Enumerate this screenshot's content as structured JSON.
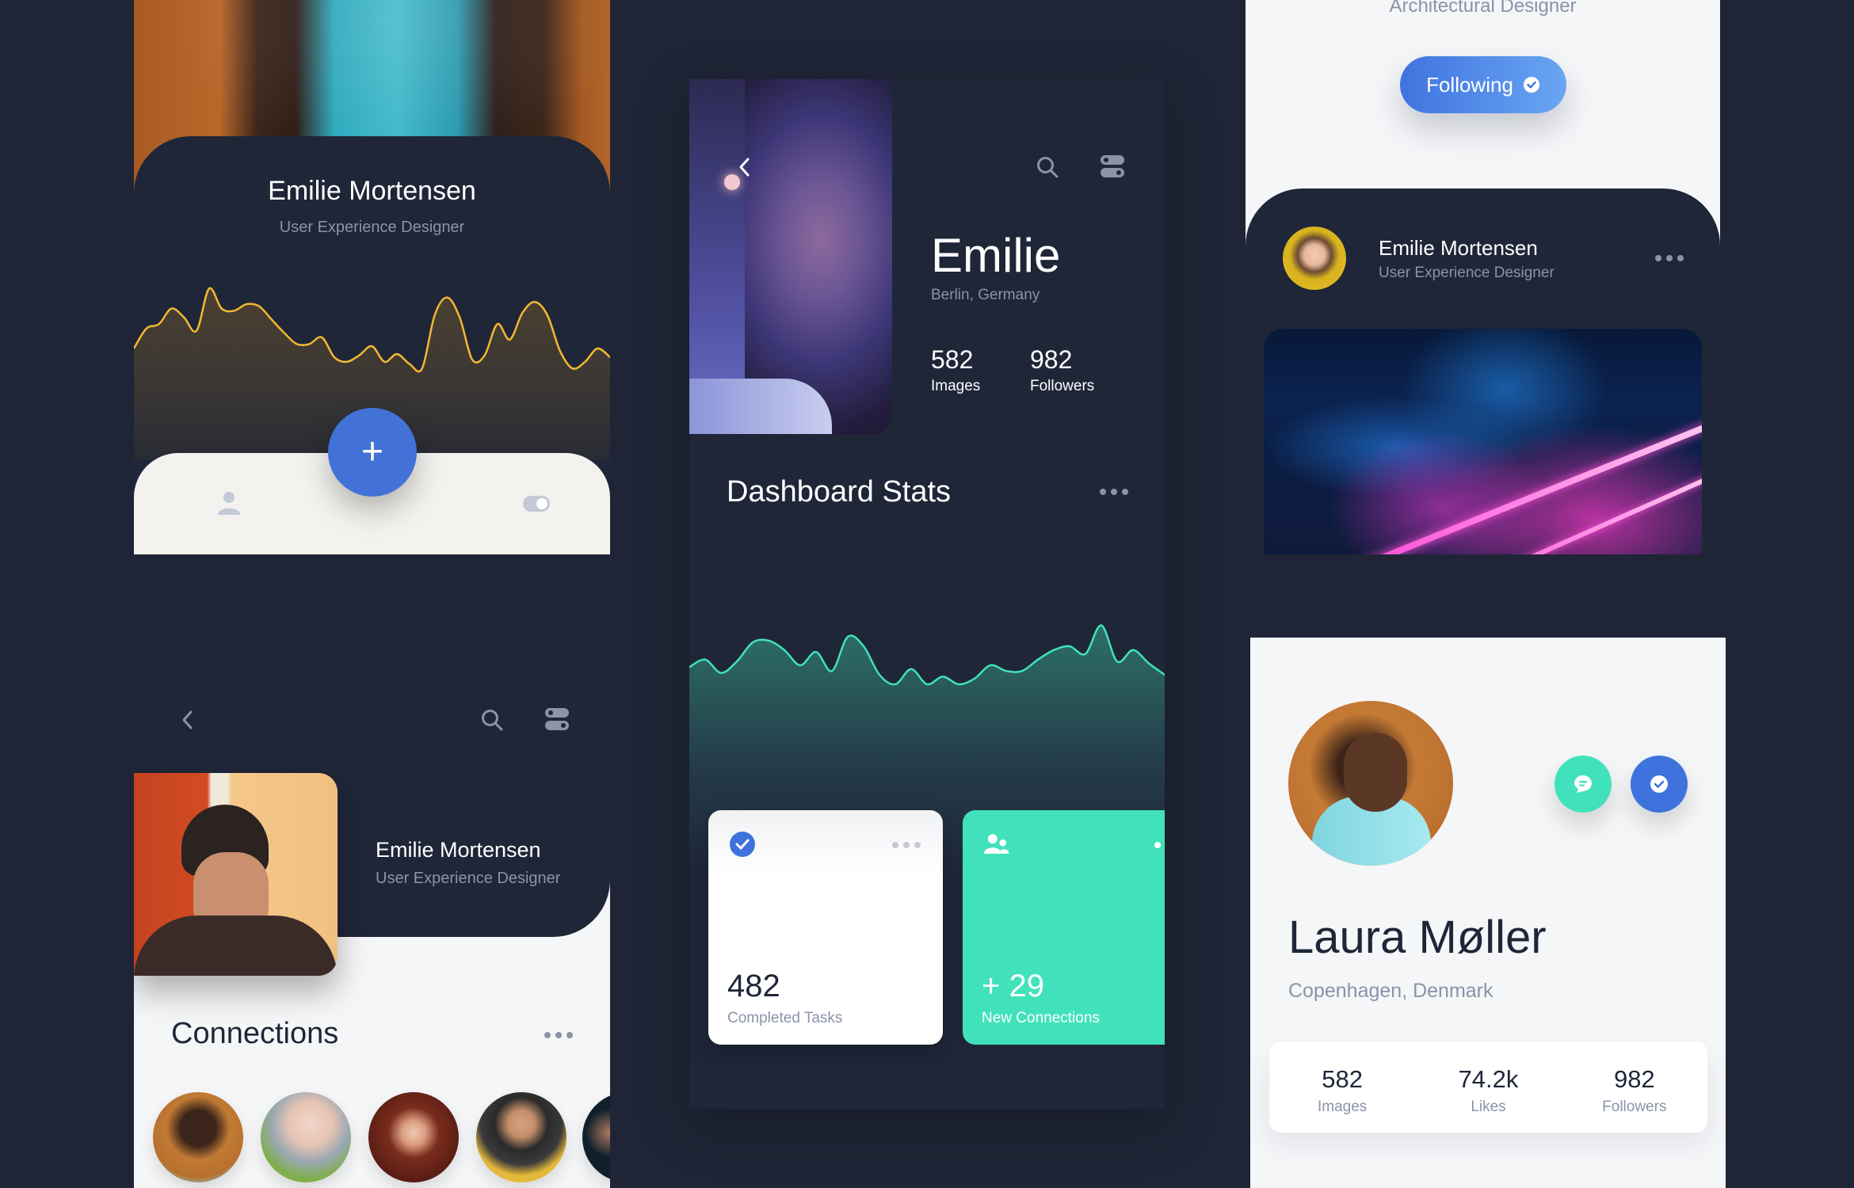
{
  "colors": {
    "background": "#1f2536",
    "panel_dark": "#1f2638",
    "panel_light": "#f5f6f8",
    "accent_blue": "#4272d7",
    "accent_teal": "#41e2bb",
    "accent_yellow": "#f5b731",
    "muted_text": "#8a93a8"
  },
  "card_profile_chart": {
    "name": "Emilie Mortensen",
    "role": "User Experience Designer",
    "fab_label": "+",
    "nav_icons": [
      "user-icon",
      "toggle-icon"
    ]
  },
  "card_dashboard": {
    "first_name": "Emilie",
    "location": "Berlin, Germany",
    "stats": [
      {
        "value": "582",
        "label": "Images"
      },
      {
        "value": "982",
        "label": "Followers"
      }
    ],
    "section_title": "Dashboard Stats",
    "tiles": [
      {
        "value": "482",
        "label": "Completed Tasks",
        "icon": "check-circle-icon"
      },
      {
        "value": "+ 29",
        "label": "New Connections",
        "icon": "users-icon"
      }
    ]
  },
  "card_following": {
    "role_top": "Architectural Designer",
    "follow_label": "Following",
    "name": "Emilie Mortensen",
    "role": "User Experience Designer"
  },
  "card_connections": {
    "name": "Emilie Mortensen",
    "role": "User Experience Designer",
    "section_title": "Connections",
    "avatar_count": 5
  },
  "card_laura": {
    "name": "Laura Møller",
    "location": "Copenhagen, Denmark",
    "stats": [
      {
        "value": "582",
        "label": "Images"
      },
      {
        "value": "74.2k",
        "label": "Likes"
      },
      {
        "value": "982",
        "label": "Followers"
      }
    ]
  },
  "chart_data": [
    {
      "type": "area",
      "title": "",
      "color": "#f5b731",
      "ylim": [
        0,
        100
      ],
      "values": [
        30,
        48,
        52,
        66,
        58,
        46,
        84,
        66,
        64,
        70,
        68,
        56,
        44,
        34,
        34,
        40,
        22,
        18,
        24,
        32,
        18,
        25,
        16,
        12,
        60,
        76,
        58,
        20,
        24,
        52,
        38,
        62,
        72,
        60,
        28,
        12,
        18,
        30,
        22
      ]
    },
    {
      "type": "area",
      "title": "Dashboard Stats",
      "color": "#41e2bb",
      "ylim": [
        0,
        100
      ],
      "values": [
        48,
        56,
        42,
        54,
        74,
        76,
        66,
        50,
        64,
        44,
        80,
        70,
        40,
        30,
        46,
        30,
        38,
        30,
        36,
        50,
        44,
        44,
        56,
        66,
        70,
        62,
        92,
        54,
        66,
        52,
        40
      ]
    }
  ]
}
